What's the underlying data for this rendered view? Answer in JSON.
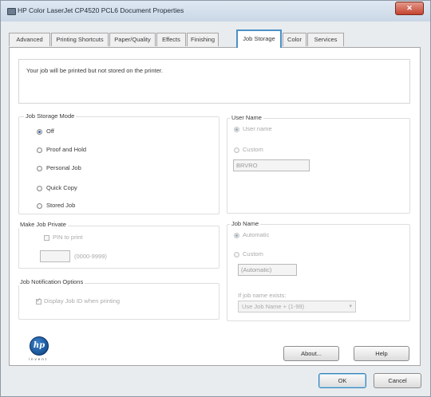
{
  "window": {
    "title": "HP Color LaserJet CP4520 PCL6 Document Properties",
    "close_glyph": "✕"
  },
  "tabs": [
    {
      "label": "Advanced",
      "active": false
    },
    {
      "label": "Printing Shortcuts",
      "active": false
    },
    {
      "label": "Paper/Quality",
      "active": false
    },
    {
      "label": "Effects",
      "active": false
    },
    {
      "label": "Finishing",
      "active": false
    },
    {
      "label": "Job Storage",
      "active": true
    },
    {
      "label": "Color",
      "active": false
    },
    {
      "label": "Services",
      "active": false
    }
  ],
  "info_text": "Your job will be printed but not stored on the printer.",
  "job_storage_mode": {
    "title": "Job Storage Mode",
    "options": [
      {
        "label": "Off",
        "selected": true
      },
      {
        "label": "Proof and Hold",
        "selected": false
      },
      {
        "label": "Personal Job",
        "selected": false
      },
      {
        "label": "Quick Copy",
        "selected": false
      },
      {
        "label": "Stored Job",
        "selected": false
      }
    ]
  },
  "user_name": {
    "title": "User Name",
    "option_user": "User name",
    "option_custom": "Custom",
    "value": "BRVRO"
  },
  "make_job_private": {
    "title": "Make Job Private",
    "pin_label": "PIN to print",
    "pin_value": "",
    "pin_range": "(0000-9999)"
  },
  "job_name": {
    "title": "Job Name",
    "option_automatic": "Automatic",
    "option_custom": "Custom",
    "value": "(Automatic)",
    "exists_label": "If job name exists:",
    "exists_value": "Use Job Name + (1-99)",
    "dropdown_glyph": "▾"
  },
  "job_notification": {
    "title": "Job Notification Options",
    "display_label": "Display Job ID when printing"
  },
  "logo": {
    "text": "hp",
    "tagline": "invent"
  },
  "buttons": {
    "about": "About...",
    "help": "Help",
    "ok": "OK",
    "cancel": "Cancel"
  }
}
